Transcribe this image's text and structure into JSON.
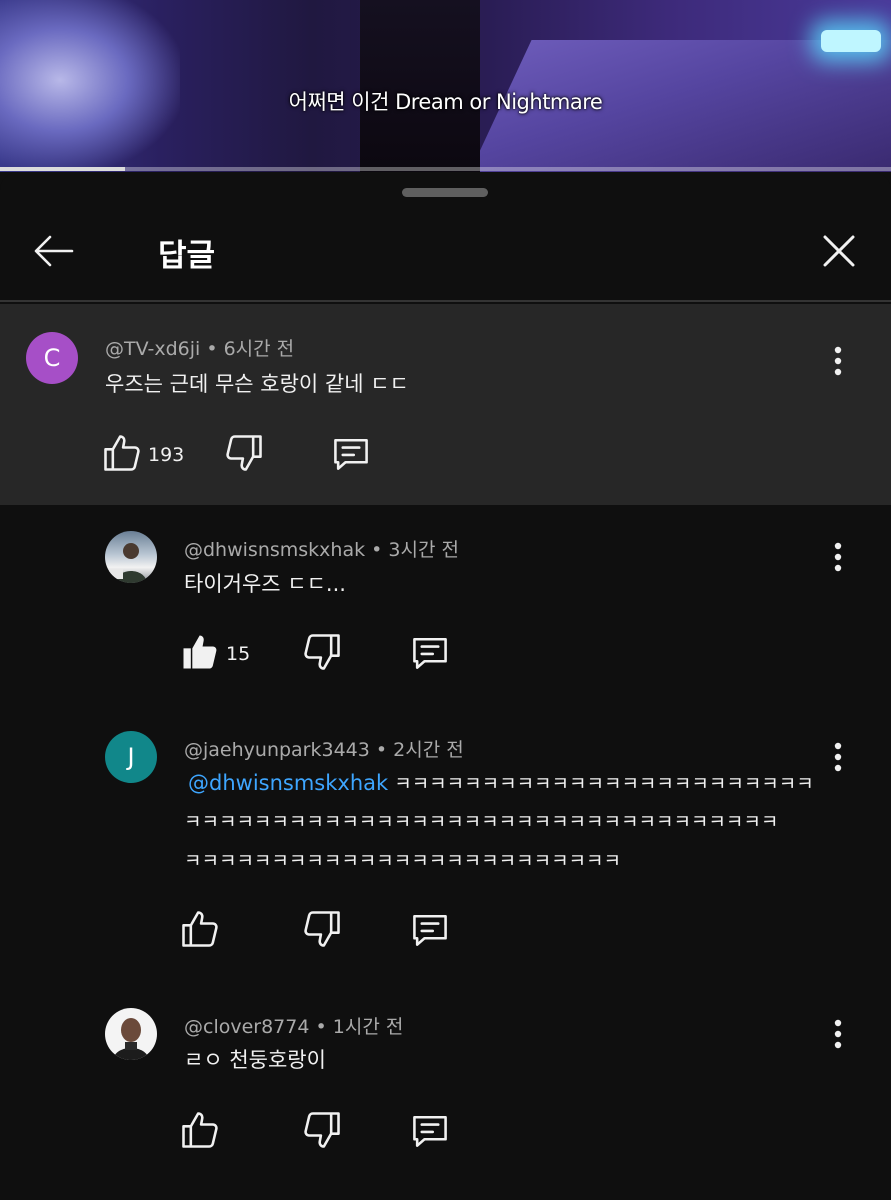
{
  "video": {
    "subtitle": "어쩌면 이건 Dream or Nightmare",
    "progress_fraction": 0.14
  },
  "header": {
    "title": "답글"
  },
  "parent_comment": {
    "avatar_letter": "C",
    "avatar_color": "#a64fc7",
    "author": "@TV-xd6ji",
    "time": "6시간 전",
    "text": "우즈는 근데 무슨 호랑이 같네 ㄷㄷ",
    "likes": "193"
  },
  "replies": [
    {
      "author": "@dhwisnsmskxhak",
      "time": "3시간 전",
      "text": "타이거우즈 ㄷㄷ...",
      "likes": "15",
      "liked": true
    },
    {
      "avatar_letter": "J",
      "avatar_color": "#11878a",
      "author": "@jaehyunpark3443",
      "time": "2시간 전",
      "mention": "@dhwisnsmskxhak",
      "text_line1": " ㅋㅋㅋㅋㅋㅋㅋㅋㅋㅋㅋㅋㅋㅋㅋㅋㅋㅋㅋㅋㅋㅋㅋㅋ",
      "text_line2": "ㅋㅋㅋㅋㅋㅋㅋㅋㅋㅋㅋㅋㅋㅋㅋㅋㅋㅋㅋㅋㅋㅋㅋㅋㅋㅋㅋㅋㅋㅋㅋㅋㅋㅋ",
      "text_line3": "ㅋㅋㅋㅋㅋㅋㅋㅋㅋㅋㅋㅋㅋㅋㅋㅋㅋㅋㅋㅋㅋㅋㅋㅋㅋ"
    },
    {
      "author": "@clover8774",
      "time": "1시간 전",
      "text": "ㄹㅇ 천둥호랑이"
    }
  ],
  "colors": {
    "background": "#0f0f0f",
    "parent_background": "#272727",
    "mention": "#3ea6ff",
    "meta": "#aaaaaa"
  },
  "icons": [
    "back-arrow-icon",
    "close-icon",
    "more-vert-icon",
    "thumbs-up-icon",
    "thumbs-down-icon",
    "reply-icon"
  ]
}
